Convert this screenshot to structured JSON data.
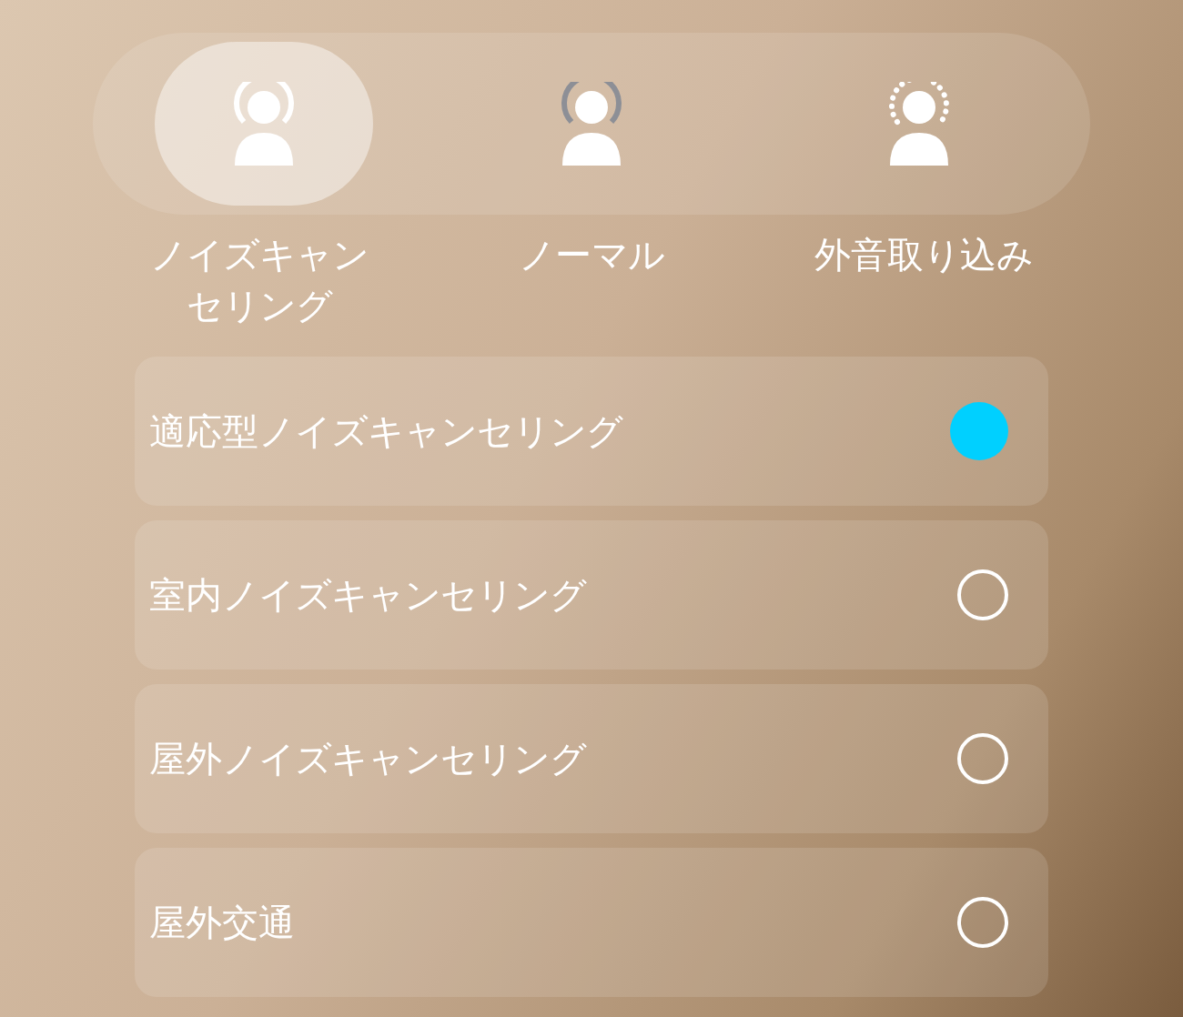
{
  "modes": [
    {
      "label": "ノイズキャンセリング",
      "kind": "ring",
      "selected": true
    },
    {
      "label": "ノーマル",
      "kind": "grey-ring",
      "selected": false
    },
    {
      "label": "外音取り込み",
      "kind": "dotted-ring",
      "selected": false
    }
  ],
  "options": [
    {
      "label": "適応型ノイズキャンセリング",
      "selected": true
    },
    {
      "label": "室内ノイズキャンセリング",
      "selected": false
    },
    {
      "label": "屋外ノイズキャンセリング",
      "selected": false
    },
    {
      "label": "屋外交通",
      "selected": false
    }
  ]
}
